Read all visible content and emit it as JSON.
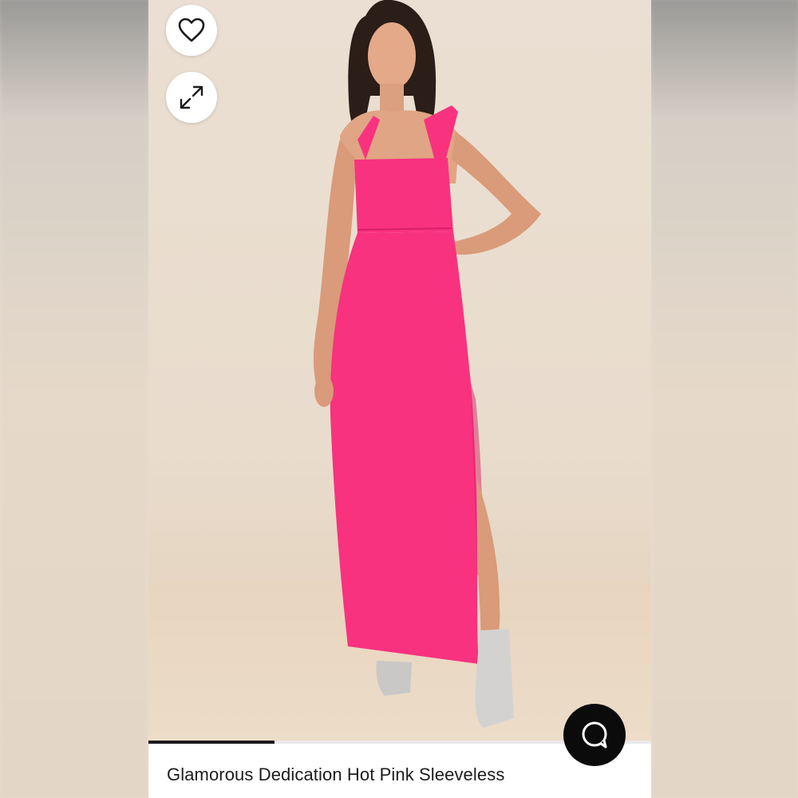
{
  "product": {
    "title": "Glamorous Dedication Hot Pink Sleeveless",
    "image_alt": "Model wearing hot pink sleeveless maxi dress"
  },
  "actions": {
    "favorite_icon": "heart-outline-icon",
    "expand_icon": "expand-arrows-icon",
    "chat_icon": "chat-bubble-icon"
  },
  "gallery": {
    "progress": 0.25
  },
  "colors": {
    "dress": "#f8327f",
    "background": "#e9dccd",
    "chat_button": "#0b0b0b"
  }
}
